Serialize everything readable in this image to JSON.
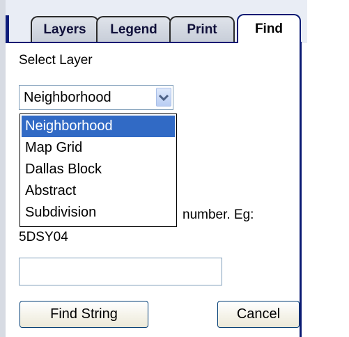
{
  "tabs": [
    {
      "label": "Layers"
    },
    {
      "label": "Legend"
    },
    {
      "label": "Print"
    },
    {
      "label": "Find"
    }
  ],
  "find_panel": {
    "select_layer_label": "Select Layer",
    "layer_select": {
      "value": "Neighborhood",
      "options": [
        "Neighborhood",
        "Map Grid",
        "Dallas Block",
        "Abstract",
        "Subdivision"
      ],
      "selected_index": 0,
      "expanded": true
    },
    "instruction_tail": "number. Eg:",
    "instruction_example": "5DSY04",
    "search_input": {
      "value": "",
      "placeholder": ""
    },
    "find_button_label": "Find String",
    "cancel_button_label": "Cancel"
  },
  "colors": {
    "accent": "#0a1a73",
    "selection": "#316ac5"
  }
}
